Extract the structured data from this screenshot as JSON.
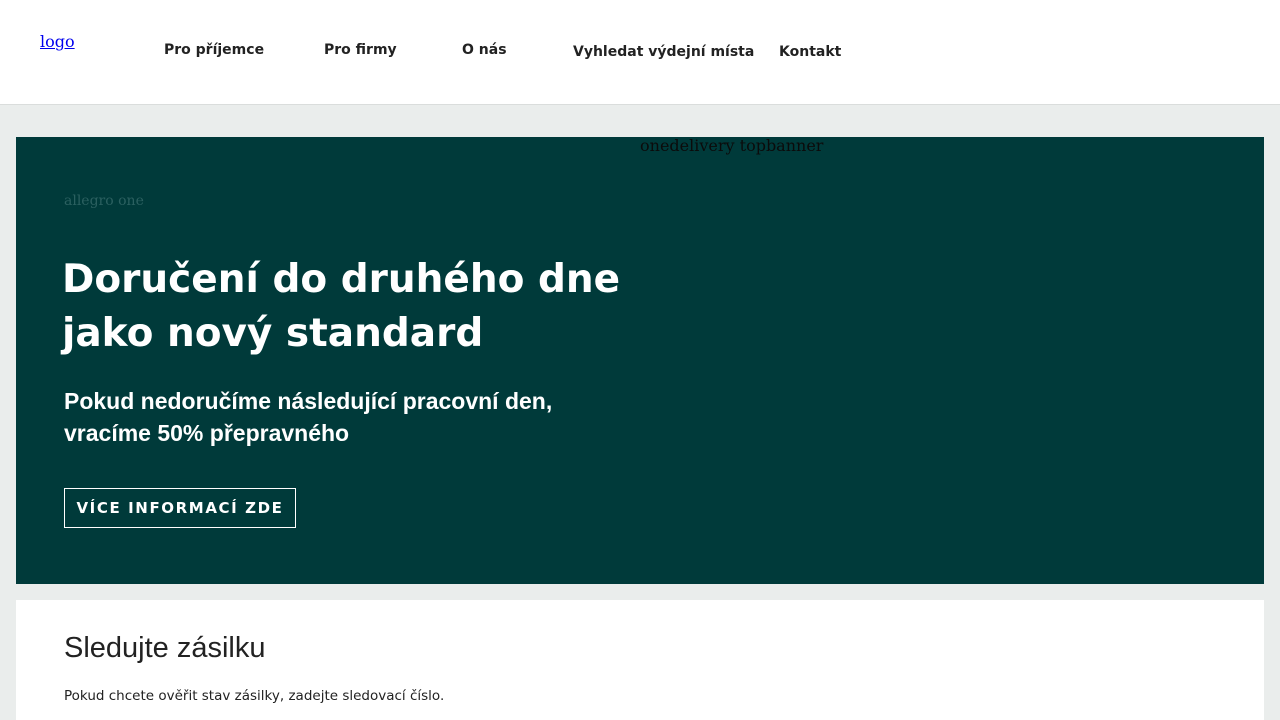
{
  "header": {
    "logo_alt": "logo",
    "nav": {
      "recipients": "Pro příjemce",
      "companies": "Pro firmy",
      "about": "O nás",
      "pickup_points": "Vyhledat výdejní místa",
      "contact": "Kontakt"
    }
  },
  "banner": {
    "image_alt": "onedelivery topbanner",
    "brand_alt": "allegro one",
    "title": "Doručení do druhého dne jako nový standard",
    "subtitle": "Pokud nedoručíme následující pracovní den, vracíme 50% přepravného",
    "button_label": "VÍCE INFORMACÍ ZDE"
  },
  "tracking": {
    "title": "Sledujte zásilku",
    "description": "Pokud chcete ověřit stav zásilky, zadejte sledovací číslo."
  },
  "colors": {
    "banner_bg": "#003a3a",
    "page_bg": "#eaedec"
  }
}
